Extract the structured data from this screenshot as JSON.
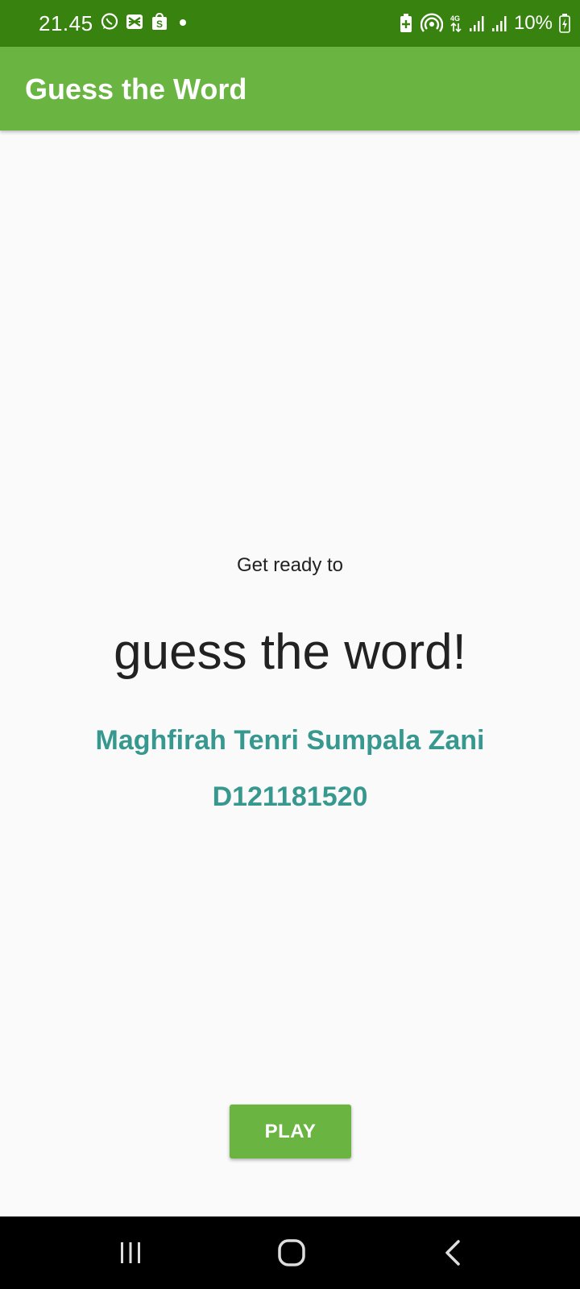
{
  "status_bar": {
    "time": "21.45",
    "left_icons": [
      "whatsapp-icon",
      "capcut-icon",
      "shopee-icon",
      "notification-dot-icon"
    ],
    "right_icons": [
      "battery-saver-icon",
      "hotspot-icon",
      "4g-icon",
      "signal-icon",
      "signal-icon"
    ],
    "battery": "10%",
    "bg_color": "#38830f"
  },
  "app_bar": {
    "title": "Guess the Word",
    "bg_color": "#6ab542"
  },
  "main": {
    "intro": "Get ready to",
    "headline": "guess the word!",
    "name": "Maghfirah Tenri Sumpala Zani",
    "student_id": "D121181520",
    "accent_color": "#36988e",
    "play_label": "PLAY"
  },
  "nav_bar": {
    "items": [
      "recents-icon",
      "home-icon",
      "back-icon"
    ]
  }
}
